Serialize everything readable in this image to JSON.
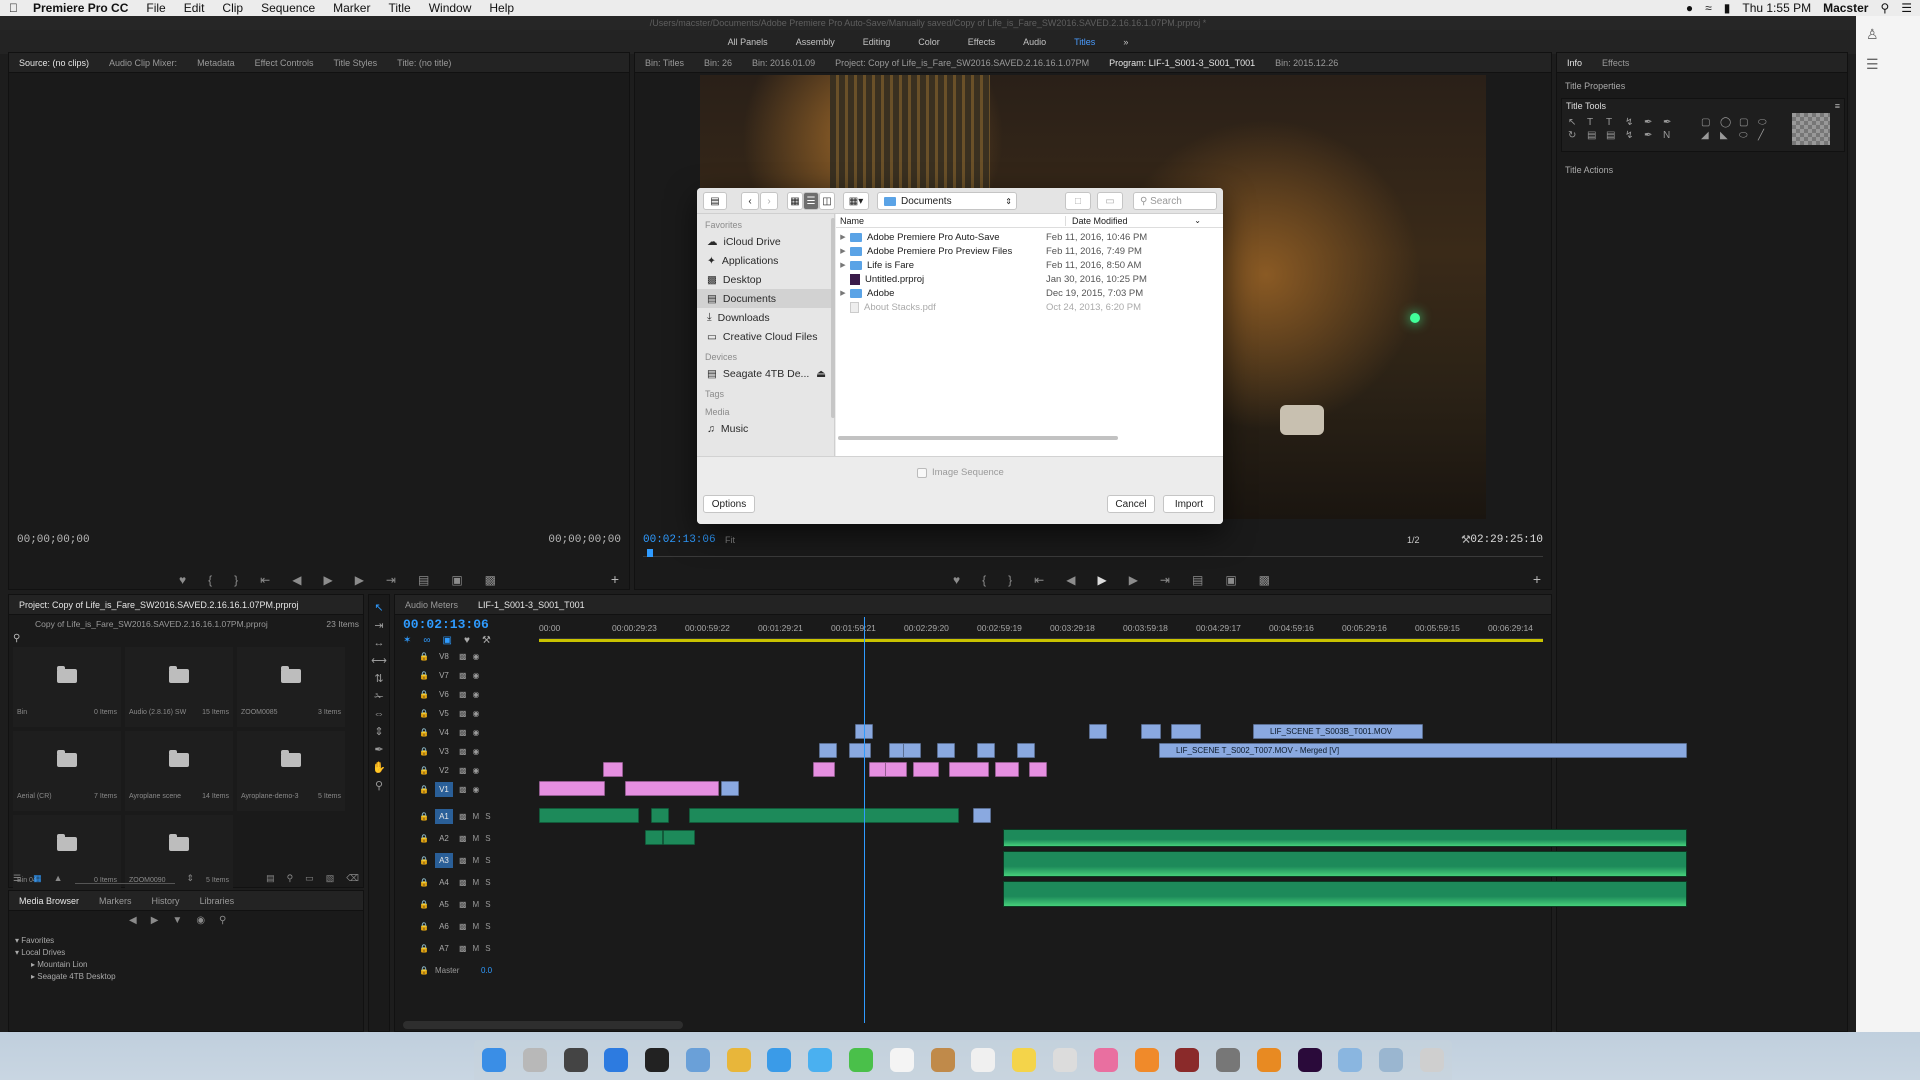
{
  "menubar": {
    "app": "Premiere Pro CC",
    "items": [
      "File",
      "Edit",
      "Clip",
      "Sequence",
      "Marker",
      "Title",
      "Window",
      "Help"
    ],
    "clock": "Thu 1:55 PM",
    "user": "Macster"
  },
  "window": {
    "path": "/Users/macster/Documents/Adobe Premiere Pro Auto-Save/Manually saved/Copy of Life_is_Fare_SW2016.SAVED.2.16.16.1.07PM.prproj *"
  },
  "workspaces": [
    "All Panels",
    "Assembly",
    "Editing",
    "Color",
    "Effects",
    "Audio",
    "Titles"
  ],
  "active_workspace": "Titles",
  "source": {
    "tabs": [
      "Source: (no clips)",
      "Audio Clip Mixer:",
      "Metadata",
      "Effect Controls",
      "Title Styles",
      "Title: (no title)"
    ],
    "tc_left": "00;00;00;00",
    "tc_right": "00;00;00;00"
  },
  "program": {
    "tabs": [
      "Bin: Titles",
      "Bin: 26",
      "Bin: 2016.01.09",
      "Project: Copy of Life_is_Fare_SW2016.SAVED.2.16.16.1.07PM",
      "Program: LIF-1_S001-3_S001_T001",
      "Bin: 2015.12.26"
    ],
    "tc_current": "00:02:13:06",
    "fit": "Fit",
    "zoom": "1/2",
    "tc_duration": "02:29:25:10"
  },
  "right": {
    "tabs": [
      "Info",
      "Effects"
    ],
    "title_properties": "Title Properties",
    "title_tools": "Title Tools",
    "title_actions": "Title Actions"
  },
  "project": {
    "title": "Project: Copy of Life_is_Fare_SW2016.SAVED.2.16.16.1.07PM.prproj",
    "file": "Copy of Life_is_Fare_SW2016.SAVED.2.16.16.1.07PM.prproj",
    "count": "23 Items",
    "bins": [
      {
        "name": "Bin",
        "count": "0 Items"
      },
      {
        "name": "Audio (2.8.16) SW",
        "count": "15 Items"
      },
      {
        "name": "ZOOM0085",
        "count": "3 Items"
      },
      {
        "name": "Aerial (CR)",
        "count": "7 Items"
      },
      {
        "name": "Ayroplane scene",
        "count": "14 Items"
      },
      {
        "name": "Ayroplane-demo-3",
        "count": "5 Items"
      },
      {
        "name": "Bin 04",
        "count": "0 Items"
      },
      {
        "name": "ZOOM0090",
        "count": "5 Items"
      }
    ]
  },
  "media": {
    "tabs": [
      "Media Browser",
      "Markers",
      "History",
      "Libraries"
    ],
    "tree": [
      "Favorites",
      "Local Drives",
      "Mountain Lion",
      "Seagate 4TB Desktop"
    ]
  },
  "timeline": {
    "tabs": [
      "Audio Meters",
      "LIF-1_S001-3_S001_T001"
    ],
    "tc": "00:02:13:06",
    "ruler": [
      "00:00",
      "00:00:29:23",
      "00:00:59:22",
      "00:01:29:21",
      "00:01:59:21",
      "00:02:29:20",
      "00:02:59:19",
      "00:03:29:18",
      "00:03:59:18",
      "00:04:29:17",
      "00:04:59:16",
      "00:05:29:16",
      "00:05:59:15",
      "00:06:29:14"
    ],
    "video_tracks": [
      "V8",
      "V7",
      "V6",
      "V5",
      "V4",
      "V3",
      "V2",
      "V1"
    ],
    "audio_tracks": [
      "A1",
      "A2",
      "A3",
      "A4",
      "A5",
      "A6",
      "A7"
    ],
    "master": "Master",
    "master_val": "0.0",
    "clip_v4": "LIF_SCENE T_S003B_T001.MOV",
    "clip_v3": "LIF_SCENE T_S002_T007.MOV - Merged [V]"
  },
  "dialog": {
    "location": "Documents",
    "search_placeholder": "Search",
    "sidebar": {
      "favorites_h": "Favorites",
      "favorites": [
        "iCloud Drive",
        "Applications",
        "Desktop",
        "Documents",
        "Downloads",
        "Creative Cloud Files"
      ],
      "devices_h": "Devices",
      "devices": [
        "Seagate 4TB De..."
      ],
      "tags_h": "Tags",
      "media_h": "Media",
      "media": [
        "Music"
      ]
    },
    "columns": {
      "name": "Name",
      "date": "Date Modified"
    },
    "files": [
      {
        "name": "Adobe Premiere Pro Auto-Save",
        "date": "Feb 11, 2016, 10:46 PM",
        "kind": "folder"
      },
      {
        "name": "Adobe Premiere Pro Preview Files",
        "date": "Feb 11, 2016, 7:49 PM",
        "kind": "folder"
      },
      {
        "name": "Life is Fare",
        "date": "Feb 11, 2016, 8:50 AM",
        "kind": "folder"
      },
      {
        "name": "Untitled.prproj",
        "date": "Jan 30, 2016, 10:25 PM",
        "kind": "proj"
      },
      {
        "name": "Adobe",
        "date": "Dec 19, 2015, 7:03 PM",
        "kind": "folder"
      },
      {
        "name": "About Stacks.pdf",
        "date": "Oct 24, 2013, 6:20 PM",
        "kind": "pdf"
      }
    ],
    "image_sequence": "Image Sequence",
    "options": "Options",
    "cancel": "Cancel",
    "import": "Import"
  },
  "colors": {
    "accent": "#2f9bff",
    "video_clip": "#8aa9e0",
    "pink_clip": "#e58fe0",
    "audio_clip": "#1d8a5a"
  }
}
